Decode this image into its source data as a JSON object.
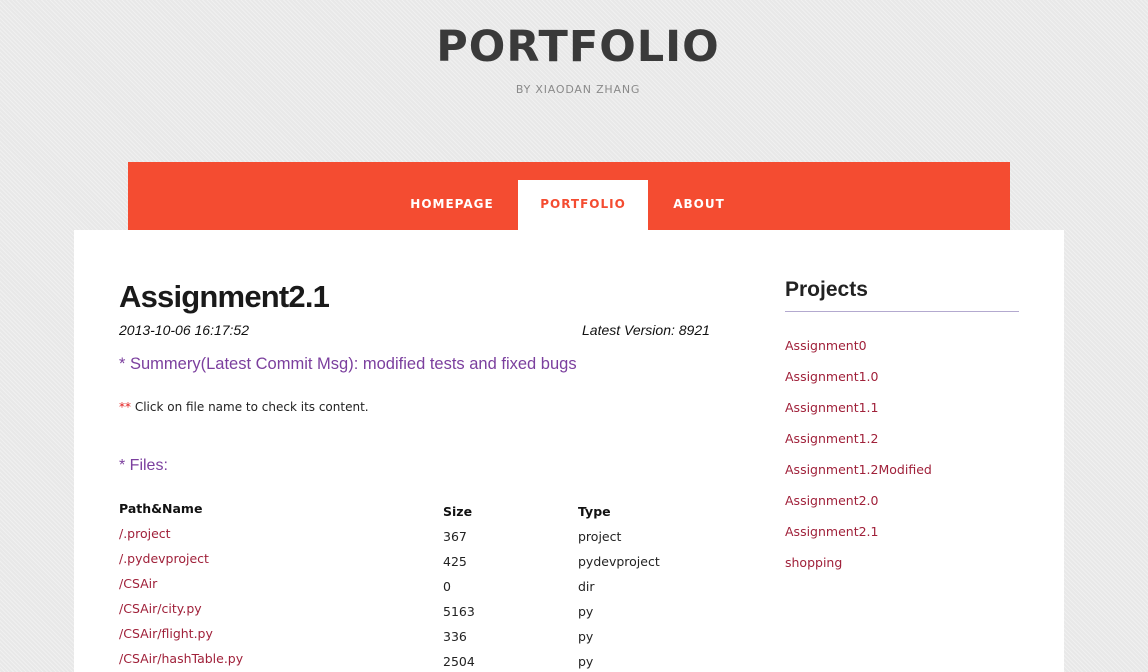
{
  "site": {
    "title": "PORTFOLIO",
    "subtitle": "BY XIAODAN ZHANG"
  },
  "nav": {
    "items": [
      {
        "label": "HOMEPAGE",
        "active": false
      },
      {
        "label": "PORTFOLIO",
        "active": true
      },
      {
        "label": "ABOUT",
        "active": false
      }
    ]
  },
  "post": {
    "title": "Assignment2.1",
    "date": "2013-10-06 16:17:52",
    "version": "Latest Version: 8921",
    "summary": "* Summery(Latest Commit Msg): modified tests and fixed bugs",
    "note_stars": "**",
    "note_text": " Click on file name to check its content.",
    "files_heading": "* Files:"
  },
  "files": {
    "headers": {
      "name": "Path&Name",
      "size": "Size",
      "type": "Type"
    },
    "rows": [
      {
        "name": "/.project",
        "size": "367",
        "type": "project"
      },
      {
        "name": "/.pydevproject",
        "size": "425",
        "type": "pydevproject"
      },
      {
        "name": "/CSAir",
        "size": "0",
        "type": "dir"
      },
      {
        "name": "/CSAir/city.py",
        "size": "5163",
        "type": "py"
      },
      {
        "name": "/CSAir/flight.py",
        "size": "336",
        "type": "py"
      },
      {
        "name": "/CSAir/hashTable.py",
        "size": "2504",
        "type": "py"
      }
    ]
  },
  "sidebar": {
    "title": "Projects",
    "projects": [
      "Assignment0",
      "Assignment1.0",
      "Assignment1.1",
      "Assignment1.2",
      "Assignment1.2Modified",
      "Assignment2.0",
      "Assignment2.1",
      "shopping"
    ]
  },
  "colors": {
    "accent": "#f44c31",
    "link": "#a0213a",
    "purple": "#7b3f9e"
  }
}
